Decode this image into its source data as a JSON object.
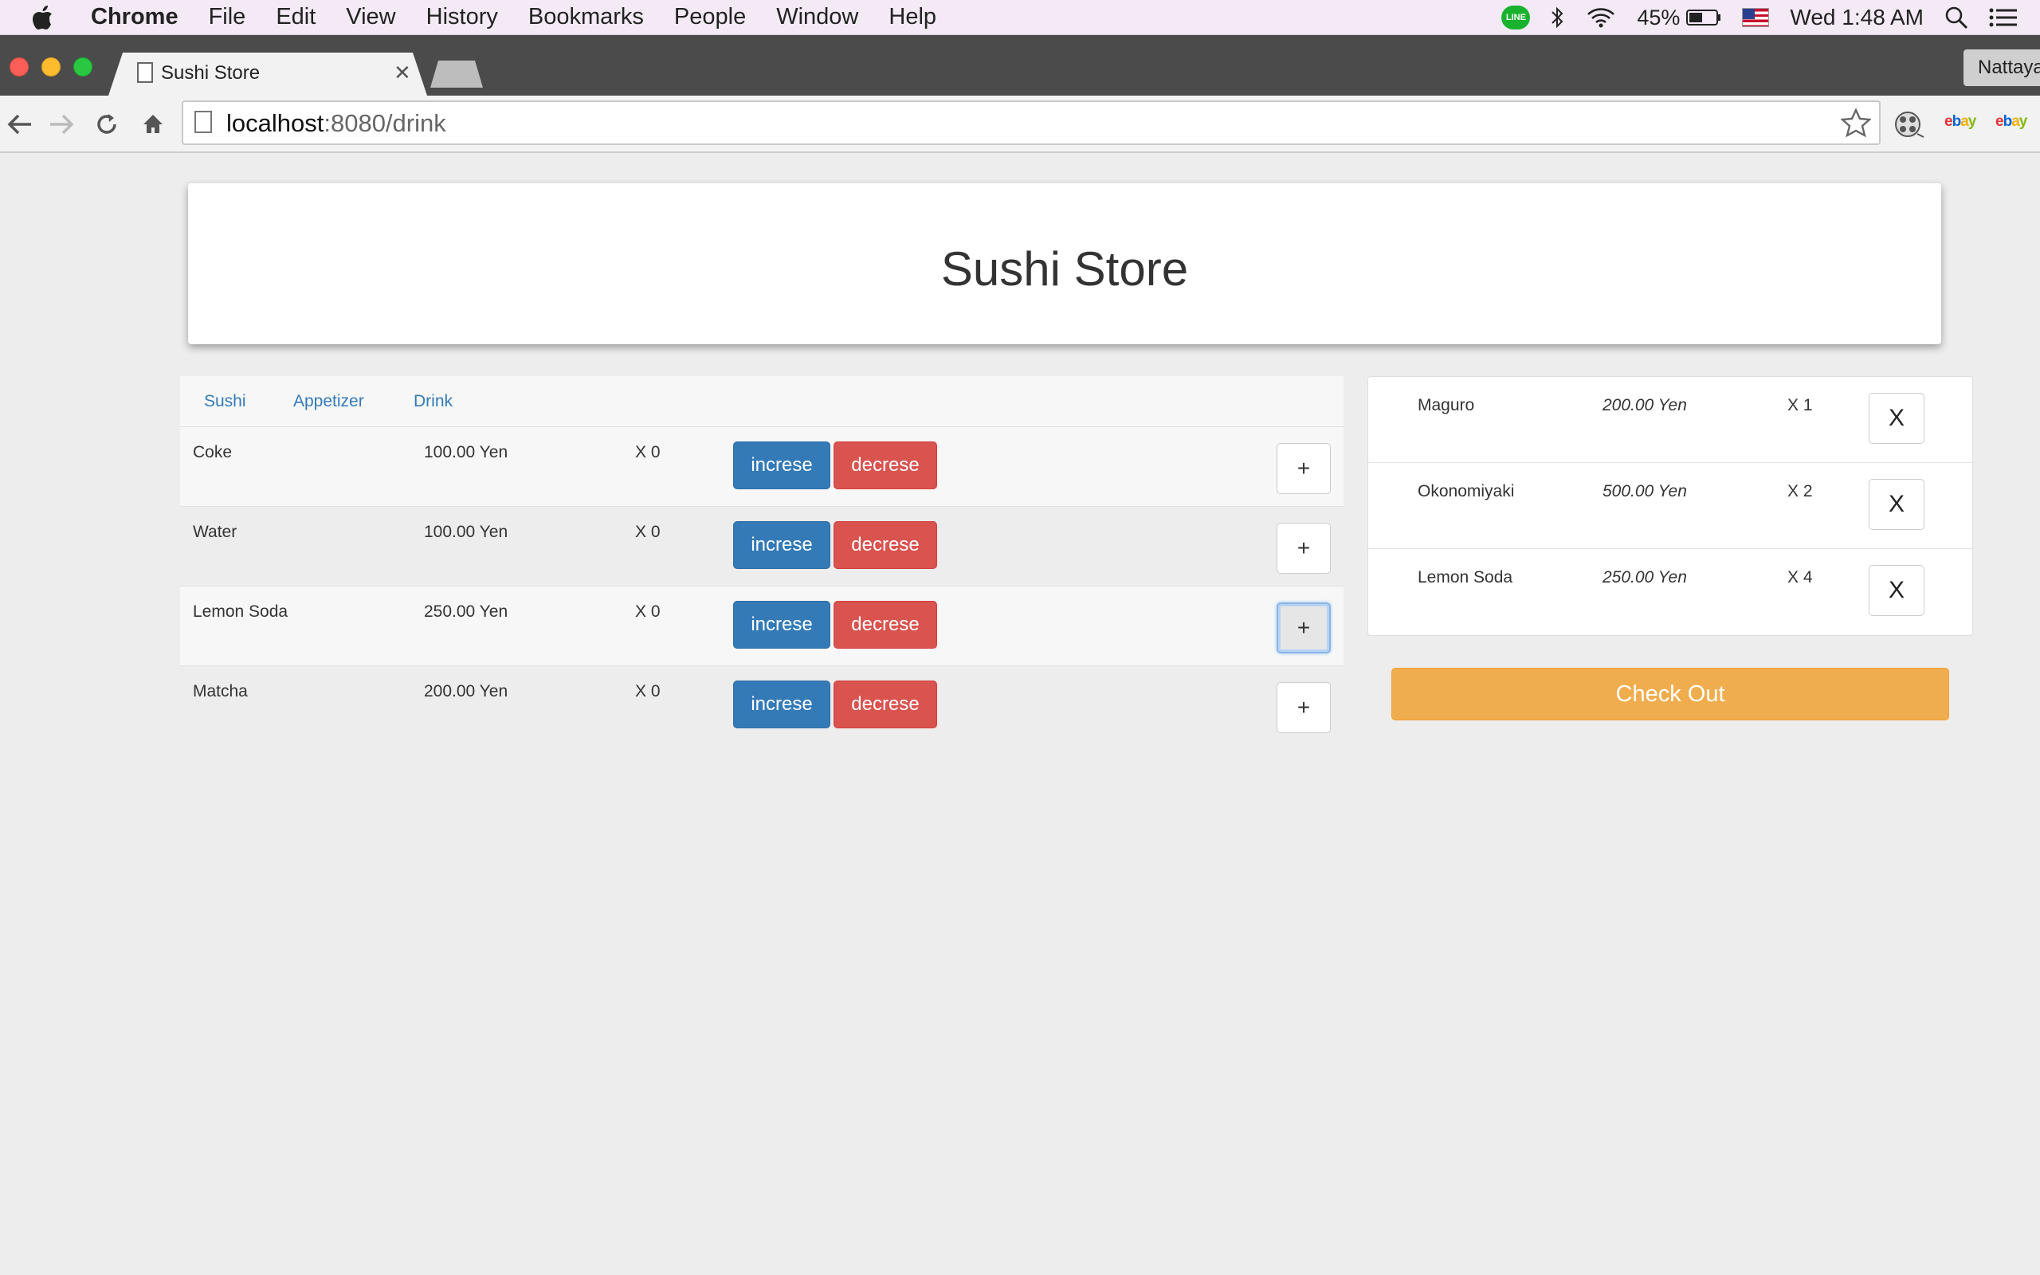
{
  "menubar": {
    "app": "Chrome",
    "items": [
      "File",
      "Edit",
      "View",
      "History",
      "Bookmarks",
      "People",
      "Window",
      "Help"
    ],
    "battery": "45%",
    "clock": "Wed 1:48 AM",
    "line_badge": "LINE"
  },
  "browser": {
    "tab_title": "Sushi Store",
    "tab_close": "✕",
    "profile": "Nattaya",
    "url_host": "localhost",
    "url_rest": ":8080/drink",
    "ebay_parts": [
      "e",
      "b",
      "a",
      "y"
    ]
  },
  "page": {
    "title": "Sushi Store",
    "categories": [
      "Sushi",
      "Appetizer",
      "Drink"
    ],
    "inc_label": "increse",
    "dec_label": "decrese",
    "add_label": "+",
    "items": [
      {
        "name": "Coke",
        "price": "100.00 Yen",
        "qty": "X 0"
      },
      {
        "name": "Water",
        "price": "100.00 Yen",
        "qty": "X 0"
      },
      {
        "name": "Lemon Soda",
        "price": "250.00 Yen",
        "qty": "X 0"
      },
      {
        "name": "Matcha",
        "price": "200.00 Yen",
        "qty": "X 0"
      }
    ],
    "cart": [
      {
        "name": "Maguro",
        "price": "200.00 Yen",
        "qty": "X 1"
      },
      {
        "name": "Okonomiyaki",
        "price": "500.00 Yen",
        "qty": "X 2"
      },
      {
        "name": "Lemon Soda",
        "price": "250.00 Yen",
        "qty": "X 4"
      }
    ],
    "remove_label": "X",
    "checkout_label": "Check Out"
  },
  "colors": {
    "primary": "#337ab7",
    "danger": "#d9534f",
    "warning": "#f0ad4e",
    "page_bg": "#ededed"
  }
}
